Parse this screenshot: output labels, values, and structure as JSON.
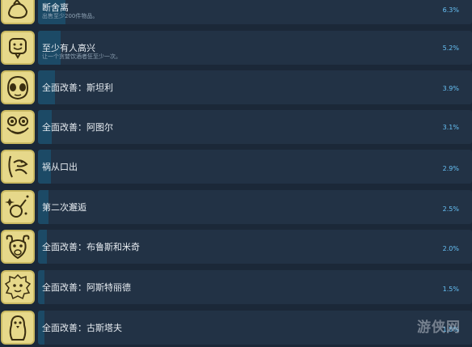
{
  "achievements": [
    {
      "title": "断舍离",
      "desc": "出售至少200件物品。",
      "pct": "6.3%",
      "pct_value": 6.3,
      "icon": "sack-icon"
    },
    {
      "title": "至少有人高兴",
      "desc": "让一个贪婪饮酒者狂至少一次。",
      "pct": "5.2%",
      "pct_value": 5.2,
      "icon": "happy-face-bubble-icon"
    },
    {
      "title": "全面改善：斯坦利",
      "desc": "",
      "pct": "3.9%",
      "pct_value": 3.9,
      "icon": "alien-face-icon"
    },
    {
      "title": "全面改善：阿图尔",
      "desc": "",
      "pct": "3.1%",
      "pct_value": 3.1,
      "icon": "frog-face-icon"
    },
    {
      "title": "祸从口出",
      "desc": "",
      "pct": "2.9%",
      "pct_value": 2.9,
      "icon": "creature-mouth-icon"
    },
    {
      "title": "第二次邂逅",
      "desc": "",
      "pct": "2.5%",
      "pct_value": 2.5,
      "icon": "ring-sparkle-icon"
    },
    {
      "title": "全面改善：布鲁斯和米奇",
      "desc": "",
      "pct": "2.0%",
      "pct_value": 2.0,
      "icon": "ram-face-icon"
    },
    {
      "title": "全面改善：阿斯特丽德",
      "desc": "",
      "pct": "1.5%",
      "pct_value": 1.5,
      "icon": "lion-face-icon"
    },
    {
      "title": "全面改善：古斯塔夫",
      "desc": "",
      "pct": "1.5%",
      "pct_value": 1.5,
      "icon": "penguin-icon"
    }
  ],
  "watermark": "游侠网"
}
